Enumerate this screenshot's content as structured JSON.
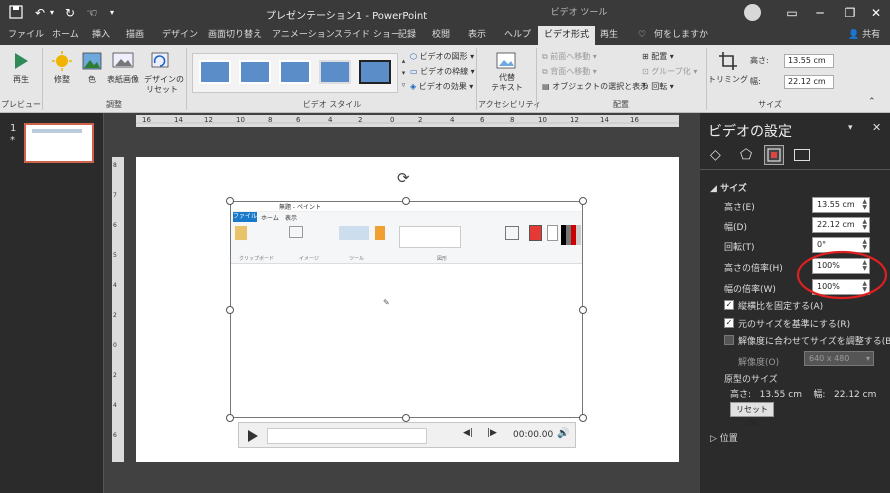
{
  "titlebar": {
    "doc_title": "プレゼンテーション1  -  PowerPoint",
    "context_tool": "ビデオ ツール"
  },
  "tabs": [
    "ファイル",
    "ホーム",
    "挿入",
    "描画",
    "デザイン",
    "画面切り替え",
    "アニメーション",
    "スライド ショー",
    "記録",
    "校閲",
    "表示",
    "ヘルプ",
    "ビデオ形式",
    "再生"
  ],
  "tell_me": "何をしますか",
  "share": "共有",
  "ribbon": {
    "preview_label": "再生",
    "preview_group": "プレビュー",
    "adjust": [
      "修整",
      "色",
      "表紙画像",
      "デザインの\nリセット"
    ],
    "adjust_group": "調整",
    "video_style_group": "ビデオ スタイル",
    "style_options": [
      "ビデオの図形",
      "ビデオの枠線",
      "ビデオの効果"
    ],
    "alt_text": "代替\nテキスト",
    "accessibility_group": "アクセシビリティ",
    "arrange": [
      "前面へ移動",
      "背面へ移動",
      "オブジェクトの選択と表示",
      "配置",
      "グループ化",
      "回転"
    ],
    "arrange_group": "配置",
    "trim": "トリミング",
    "height_label": "高さ:",
    "width_label": "幅:",
    "height_value": "13.55 cm",
    "width_value": "22.12 cm",
    "size_group": "サイズ"
  },
  "thumb": {
    "number": "1",
    "star": "*"
  },
  "slide_video": {
    "paint_title": "無題 - ペイント",
    "paint_tabs": [
      "ファイル",
      "ホーム",
      "表示"
    ],
    "paint_groups": [
      "クリップボード",
      "イメージ",
      "ツール",
      "図形"
    ],
    "time": "00:00.00"
  },
  "rightpane": {
    "title": "ビデオの設定",
    "section_size": "サイズ",
    "height_label": "高さ(E)",
    "width_label": "幅(D)",
    "rotate_label": "回転(T)",
    "scale_h_label": "高さの倍率(H)",
    "scale_w_label": "幅の倍率(W)",
    "height_value": "13.55 cm",
    "width_value": "22.12 cm",
    "rotate_value": "0°",
    "scale_h_value": "100%",
    "scale_w_value": "100%",
    "lock_aspect": "縦横比を固定する(A)",
    "relative_original": "元のサイズを基準にする(R)",
    "best_scale": "解像度に合わせてサイズを調整する(B)",
    "resolution_label": "解像度(O)",
    "resolution_value": "640 x 480",
    "original_size": "原型のサイズ",
    "original_dims": "高さ:   13.55 cm    幅:   22.12 cm",
    "reset": "リセット(S)",
    "section_position": "位置"
  }
}
